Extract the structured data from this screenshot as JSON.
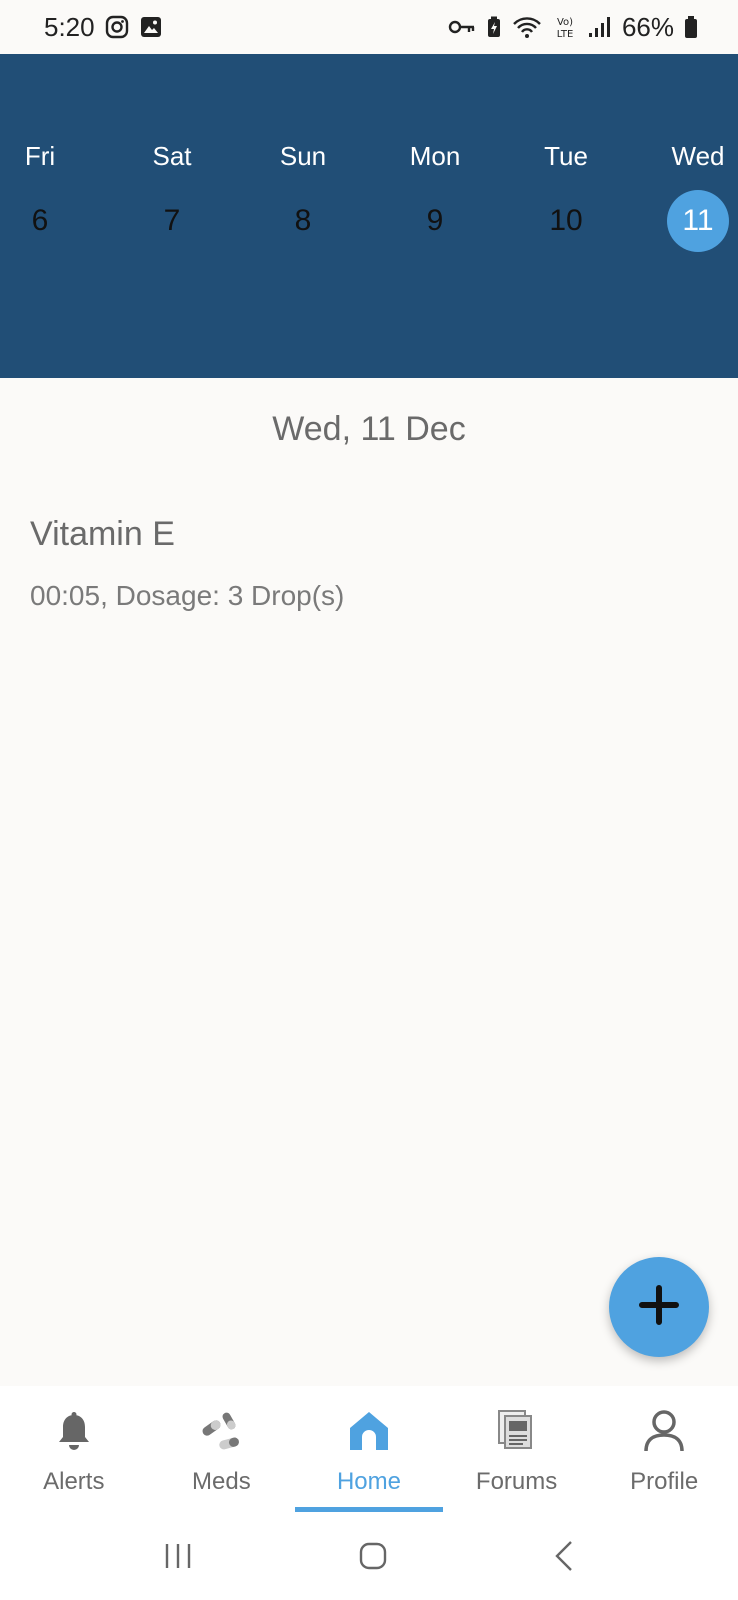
{
  "status_bar": {
    "time": "5:20",
    "battery": "66%",
    "icons_left": [
      "instagram-icon",
      "gallery-icon"
    ],
    "icons_right": [
      "vpn-key-icon",
      "battery-saver-icon",
      "wifi-icon",
      "volte-icon",
      "signal-icon",
      "battery-icon"
    ]
  },
  "calendar": {
    "days": [
      {
        "name": "Fri",
        "num": "6"
      },
      {
        "name": "Sat",
        "num": "7"
      },
      {
        "name": "Sun",
        "num": "8"
      },
      {
        "name": "Mon",
        "num": "9"
      },
      {
        "name": "Tue",
        "num": "10"
      },
      {
        "name": "Wed",
        "num": "11"
      }
    ],
    "selected_index": 5,
    "header_color": "#214e76",
    "accent_color": "#4fa2e0"
  },
  "main": {
    "date_title": "Wed, 11 Dec",
    "meds": [
      {
        "name": "Vitamin E",
        "detail": "00:05, Dosage: 3 Drop(s)"
      }
    ]
  },
  "fab": {
    "icon": "plus-icon"
  },
  "bottom_nav": {
    "items": [
      {
        "label": "Alerts",
        "icon": "bell-icon"
      },
      {
        "label": "Meds",
        "icon": "pills-icon"
      },
      {
        "label": "Home",
        "icon": "home-icon"
      },
      {
        "label": "Forums",
        "icon": "forums-icon"
      },
      {
        "label": "Profile",
        "icon": "person-icon"
      }
    ],
    "active_label": "Home"
  },
  "system_nav": {
    "icons": [
      "recent-apps-icon",
      "home-button-icon",
      "back-icon"
    ]
  }
}
